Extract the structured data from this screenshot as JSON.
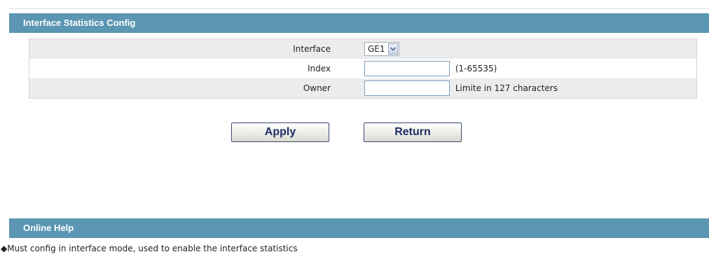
{
  "config_panel": {
    "title": "Interface Statistics Config",
    "rows": {
      "interface": {
        "label": "Interface",
        "selected": "GE1"
      },
      "index": {
        "label": "Index",
        "value": "",
        "hint": "(1-65535)"
      },
      "owner": {
        "label": "Owner",
        "value": "",
        "hint": "Limite in 127 characters"
      }
    }
  },
  "actions": {
    "apply_label": "Apply",
    "return_label": "Return"
  },
  "help_panel": {
    "title": "Online Help",
    "bullet": "◆",
    "text": "Must config in interface mode, used to enable the interface statistics"
  },
  "colors": {
    "header_bg": "#5b96b3",
    "row_shade": "#ececec",
    "button_text": "#1d2d63"
  }
}
